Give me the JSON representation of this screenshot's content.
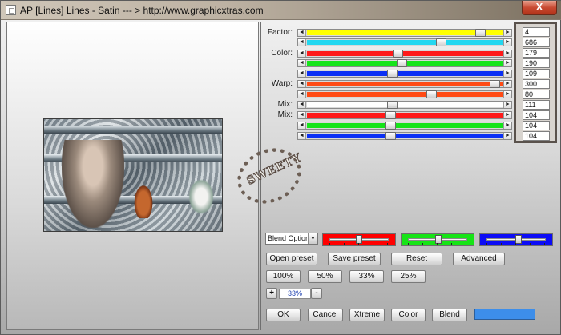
{
  "window": {
    "title": "AP [Lines]  Lines - Satin    --- > http://www.graphicxtras.com",
    "close_label": "X"
  },
  "preview": {
    "stamp_text": "SWEETY"
  },
  "sliders": [
    {
      "label": "Factor:",
      "color": "#ffff00",
      "value": "4",
      "level": 0.9
    },
    {
      "label": "",
      "color": "#22d7f0",
      "value": "686",
      "level": 0.69
    },
    {
      "label": "Color:",
      "color": "#ff1a1a",
      "value": "179",
      "level": 0.46
    },
    {
      "label": "",
      "color": "#15e41a",
      "value": "190",
      "level": 0.48
    },
    {
      "label": "",
      "color": "#0a2ff5",
      "value": "109",
      "level": 0.43
    },
    {
      "label": "Warp:",
      "color": "#ff4a14",
      "value": "300",
      "level": 0.98
    },
    {
      "label": "",
      "color": "#ff4a14",
      "value": "80",
      "level": 0.64
    },
    {
      "label": "Mix:",
      "color": "#ffffff",
      "value": "111",
      "level": 0.43
    },
    {
      "label": "Mix:",
      "color": "#ff1a1a",
      "value": "104",
      "level": 0.42
    },
    {
      "label": "",
      "color": "#15e41a",
      "value": "104",
      "level": 0.42
    },
    {
      "label": "",
      "color": "#0a2ff5",
      "value": "104",
      "level": 0.42
    }
  ],
  "blend": {
    "select_value": "Blend Option",
    "sliders": [
      {
        "color": "#ff0000",
        "level": 0.5
      },
      {
        "color": "#16e416",
        "level": 0.52
      },
      {
        "color": "#0c0cf5",
        "level": 0.55
      }
    ]
  },
  "buttons": {
    "open_preset": "Open preset",
    "save_preset": "Save preset",
    "reset": "Reset",
    "advanced": "Advanced",
    "zoom_100": "100%",
    "zoom_50": "50%",
    "zoom_33": "33%",
    "zoom_25": "25%",
    "zoom_in": "+",
    "zoom_out": "-",
    "ok": "OK",
    "cancel": "Cancel",
    "xtreme": "Xtreme",
    "color": "Color",
    "blend": "Blend"
  },
  "zoom": {
    "current": "33%"
  },
  "color_swatch": "#3d8eea"
}
